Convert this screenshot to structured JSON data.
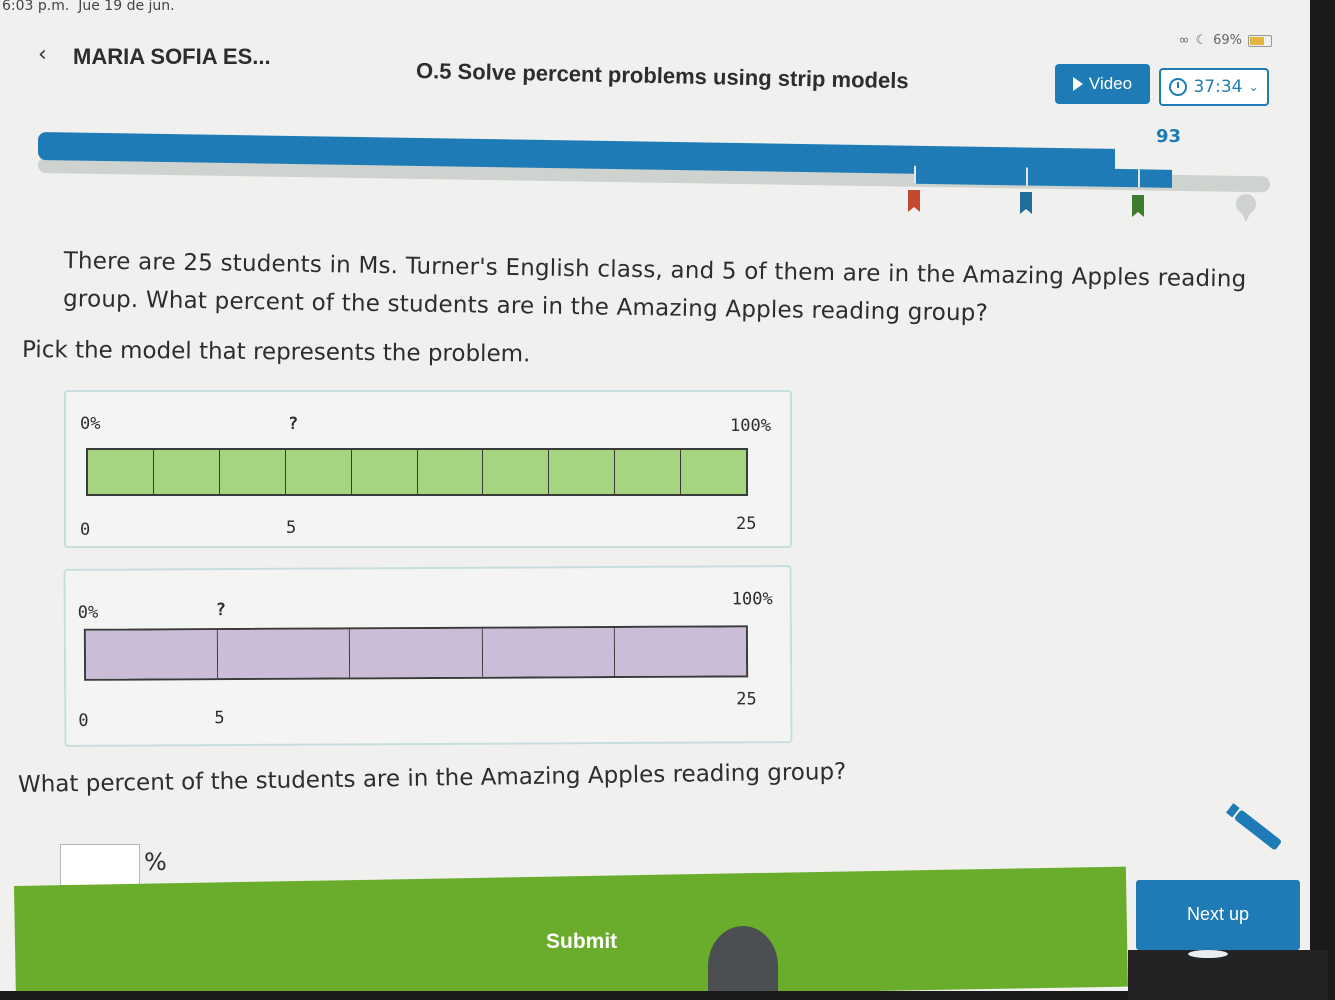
{
  "status": {
    "time": "6:03 p.m.",
    "date": "Jue 19 de jun.",
    "battery": "69%"
  },
  "header": {
    "back_icon": "chevron-left-icon",
    "student_name": "MARIA SOFIA ES...",
    "skill_title": "O.5 Solve percent problems using strip models",
    "video_label": "Video",
    "timer": "37:34",
    "score": "93"
  },
  "progress": {
    "score_value": 93,
    "fill_fraction": 0.93
  },
  "question": {
    "text": "There are 25 students in Ms. Turner's English class, and 5 of them are in the Amazing Apples reading group. What percent of the students are in the Amazing Apples reading group?",
    "instruction": "Pick the model that represents the problem."
  },
  "options": [
    {
      "top_left": "0%",
      "top_mid": "?",
      "top_right": "100%",
      "bottom_left": "0",
      "bottom_mid": "5",
      "bottom_right": "25",
      "cells": 10,
      "color": "#a7d47e"
    },
    {
      "top_left": "0%",
      "top_mid": "?",
      "top_right": "100%",
      "bottom_left": "0",
      "bottom_mid": "5",
      "bottom_right": "25",
      "cells": 5,
      "color": "#cbbdd8"
    }
  ],
  "answer": {
    "prompt": "What percent of the students are in the Amazing Apples reading group?",
    "value": "",
    "suffix": "%"
  },
  "buttons": {
    "submit": "Submit",
    "next": "Next up"
  },
  "colors": {
    "accent": "#1f7bb5",
    "submit": "#6aad2c"
  }
}
